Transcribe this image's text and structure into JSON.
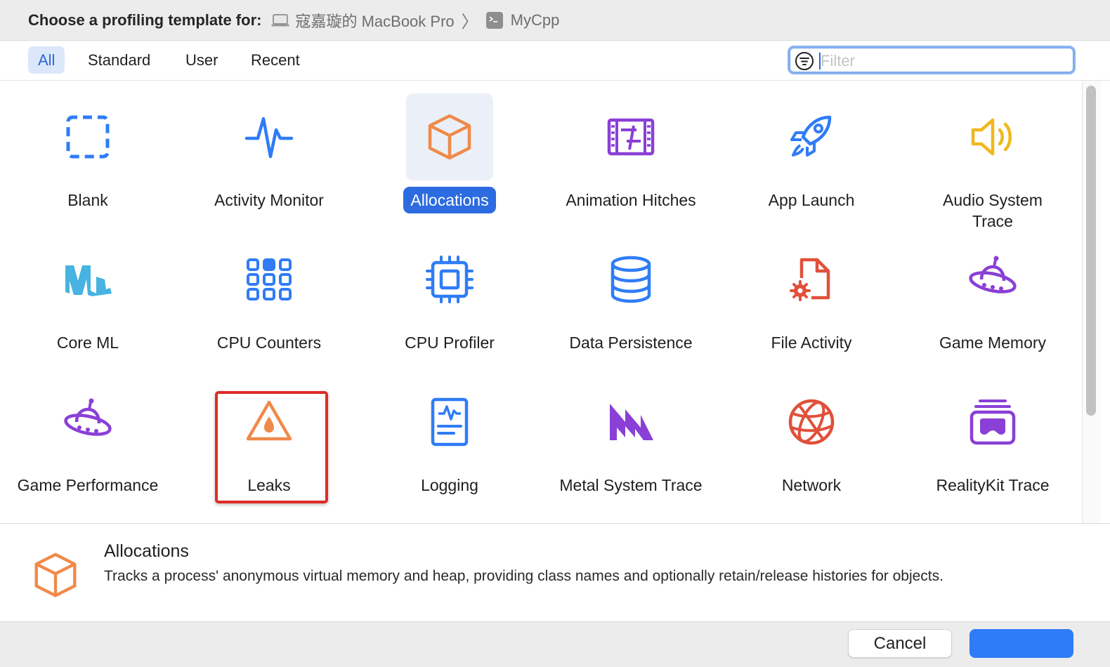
{
  "header": {
    "prompt": "Choose a profiling template for:",
    "device": "寇嘉璇的 MacBook Pro",
    "target": "MyCpp"
  },
  "tabs": [
    {
      "label": "All",
      "active": true
    },
    {
      "label": "Standard",
      "active": false
    },
    {
      "label": "User",
      "active": false
    },
    {
      "label": "Recent",
      "active": false
    }
  ],
  "filter": {
    "placeholder": "Filter",
    "value": ""
  },
  "templates": [
    {
      "name": "Blank",
      "icon": "dashed-square-icon",
      "color": "#2f7cf6"
    },
    {
      "name": "Activity Monitor",
      "icon": "waveform-icon",
      "color": "#2f7cf6"
    },
    {
      "name": "Allocations",
      "icon": "cube-icon",
      "color": "#ef8a4a",
      "selected": true
    },
    {
      "name": "Animation Hitches",
      "icon": "film-strip-icon",
      "color": "#8a3fd6"
    },
    {
      "name": "App Launch",
      "icon": "rocket-icon",
      "color": "#2f7cf6"
    },
    {
      "name": "Audio System Trace",
      "icon": "speaker-icon",
      "color": "#f0b81d"
    },
    {
      "name": "Core ML",
      "icon": "ml-icon",
      "color": "#46b3e0"
    },
    {
      "name": "CPU Counters",
      "icon": "grid-squares-icon",
      "color": "#2f7cf6"
    },
    {
      "name": "CPU Profiler",
      "icon": "cpu-chip-icon",
      "color": "#2f7cf6"
    },
    {
      "name": "Data Persistence",
      "icon": "database-icon",
      "color": "#2f7cf6"
    },
    {
      "name": "File Activity",
      "icon": "file-gear-icon",
      "color": "#e0503a"
    },
    {
      "name": "Game Memory",
      "icon": "ufo-icon",
      "color": "#8a3fd6"
    },
    {
      "name": "Game Performance",
      "icon": "ufo-icon",
      "color": "#8a3fd6"
    },
    {
      "name": "Leaks",
      "icon": "leak-warning-icon",
      "color": "#ef8a4a",
      "highlighted": true
    },
    {
      "name": "Logging",
      "icon": "log-document-icon",
      "color": "#2f7cf6"
    },
    {
      "name": "Metal System Trace",
      "icon": "metal-icon",
      "color": "#8a3fd6"
    },
    {
      "name": "Network",
      "icon": "globe-icon",
      "color": "#e0503a"
    },
    {
      "name": "RealityKit Trace",
      "icon": "vision-stack-icon",
      "color": "#8a3fd6"
    }
  ],
  "details": {
    "title": "Allocations",
    "description": "Tracks a process' anonymous virtual memory and heap, providing class names and optionally retain/release histories for objects."
  },
  "footer": {
    "cancel_label": "Cancel",
    "primary_label": ""
  },
  "colors": {
    "accent": "#2d6be0",
    "highlight_border": "#e02b27"
  }
}
